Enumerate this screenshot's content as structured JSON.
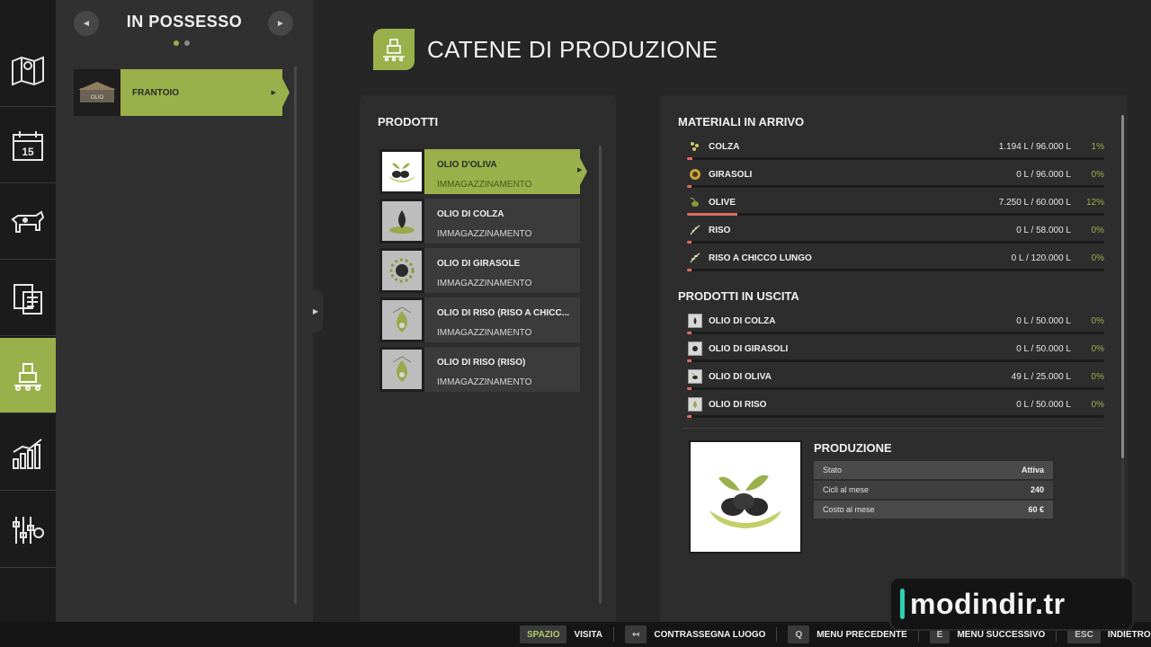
{
  "rail": {
    "items": [
      {
        "icon": "map-icon"
      },
      {
        "icon": "calendar-icon",
        "label": "15"
      },
      {
        "icon": "cow-icon"
      },
      {
        "icon": "documents-icon"
      },
      {
        "icon": "production-chain-icon"
      },
      {
        "icon": "statistics-icon"
      },
      {
        "icon": "settings-sliders-icon"
      }
    ],
    "active_index": 4
  },
  "owned": {
    "title": "IN POSSESSO",
    "prev_icon": "◄",
    "next_icon": "►",
    "items": [
      {
        "label": "FRANTOIO",
        "thumb_text": "OLIO"
      }
    ]
  },
  "header": {
    "title": "CATENE DI PRODUZIONE"
  },
  "products": {
    "heading": "PRODOTTI",
    "items": [
      {
        "name": "OLIO D'OLIVA",
        "status": "IMMAGAZZINAMENTO",
        "selected": true
      },
      {
        "name": "OLIO DI COLZA",
        "status": "IMMAGAZZINAMENTO",
        "selected": false
      },
      {
        "name": "OLIO DI GIRASOLE",
        "status": "IMMAGAZZINAMENTO",
        "selected": false
      },
      {
        "name": "OLIO DI RISO (RISO A CHICC...",
        "status": "IMMAGAZZINAMENTO",
        "selected": false
      },
      {
        "name": "OLIO DI RISO (RISO)",
        "status": "IMMAGAZZINAMENTO",
        "selected": false
      }
    ]
  },
  "materials": {
    "incoming_heading": "MATERIALI IN ARRIVO",
    "incoming": [
      {
        "name": "COLZA",
        "amount": "1.194 L / 96.000 L",
        "percent": "1%",
        "fill": 0.012,
        "icon": "canola-icon"
      },
      {
        "name": "GIRASOLI",
        "amount": "0 L / 96.000 L",
        "percent": "0%",
        "fill": 0.0,
        "icon": "sunflower-icon"
      },
      {
        "name": "OLIVE",
        "amount": "7.250 L / 60.000 L",
        "percent": "12%",
        "fill": 0.12,
        "icon": "olive-icon"
      },
      {
        "name": "RISO",
        "amount": "0 L / 58.000 L",
        "percent": "0%",
        "fill": 0.0,
        "icon": "rice-icon"
      },
      {
        "name": "RISO A CHICCO LUNGO",
        "amount": "0 L / 120.000 L",
        "percent": "0%",
        "fill": 0.0,
        "icon": "long-grain-rice-icon"
      }
    ],
    "outgoing_heading": "PRODOTTI IN USCITA",
    "outgoing": [
      {
        "name": "OLIO DI COLZA",
        "amount": "0 L / 50.000 L",
        "percent": "0%",
        "fill": 0.0,
        "icon": "canola-oil-icon"
      },
      {
        "name": "OLIO DI GIRASOLI",
        "amount": "0 L / 50.000 L",
        "percent": "0%",
        "fill": 0.0,
        "icon": "sunflower-oil-icon"
      },
      {
        "name": "OLIO DI OLIVA",
        "amount": "49 L / 25.000 L",
        "percent": "0%",
        "fill": 0.002,
        "icon": "olive-oil-icon"
      },
      {
        "name": "OLIO DI RISO",
        "amount": "0 L / 50.000 L",
        "percent": "0%",
        "fill": 0.0,
        "icon": "rice-oil-icon"
      }
    ]
  },
  "production": {
    "heading": "PRODUZIONE",
    "rows": [
      {
        "key": "Stato",
        "value": "Attiva"
      },
      {
        "key": "Cicli al mese",
        "value": "240"
      },
      {
        "key": "Costo al mese",
        "value": "60 €"
      }
    ]
  },
  "bottombar": {
    "hints": [
      {
        "key": "SPAZIO",
        "label": "VISITA",
        "accent": true
      },
      {
        "key": "↤",
        "label": "CONTRASSEGNA LUOGO"
      },
      {
        "key": "Q",
        "label": "MENU PRECEDENTE"
      },
      {
        "key": "E",
        "label": "MENU SUCCESSIVO"
      },
      {
        "key": "ESC",
        "label": "INDIETRO"
      }
    ]
  },
  "watermark": {
    "text": "modindir.tr"
  },
  "colors": {
    "accent": "#9ab04a",
    "bar_fill": "#e06b5e",
    "percent": "#9ab04a",
    "watermark_bar": "#2fd2b4"
  }
}
